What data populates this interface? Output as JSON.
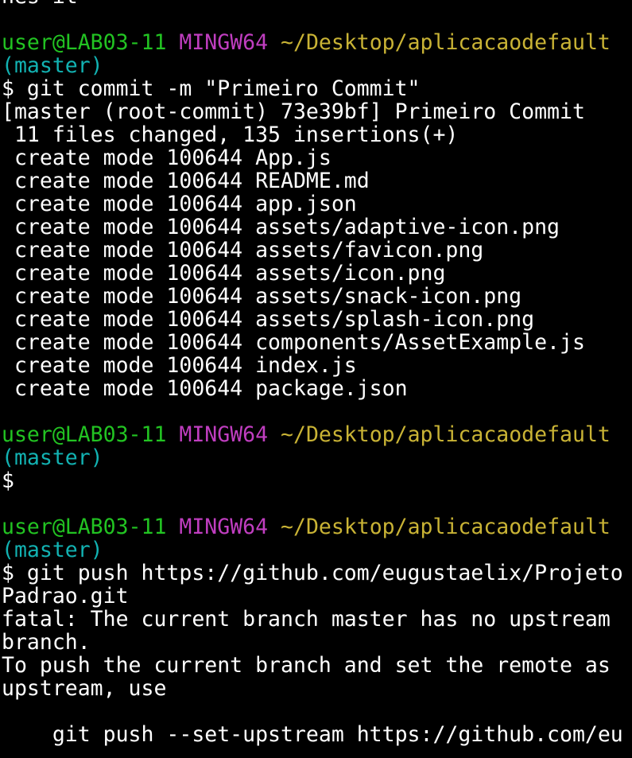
{
  "colors": {
    "background": "#000000",
    "text": "#ffffff",
    "user_host": "#22c322",
    "shell": "#c03ec0",
    "path": "#c9b335",
    "branch": "#12b2b2"
  },
  "lines": [
    {
      "segments": [
        {
          "text": "hes it",
          "color": "white"
        }
      ]
    },
    {
      "segments": []
    },
    {
      "segments": [
        {
          "text": "user@LAB03-11",
          "color": "green"
        },
        {
          "text": " ",
          "color": "white"
        },
        {
          "text": "MINGW64",
          "color": "magenta"
        },
        {
          "text": " ",
          "color": "white"
        },
        {
          "text": "~/Desktop/aplicacaodefault",
          "color": "yellow"
        }
      ]
    },
    {
      "segments": [
        {
          "text": "(master)",
          "color": "cyan"
        }
      ]
    },
    {
      "segments": [
        {
          "text": "$ git commit -m \"Primeiro Commit\"",
          "color": "white"
        }
      ]
    },
    {
      "segments": [
        {
          "text": "[master (root-commit) 73e39bf] Primeiro Commit",
          "color": "white"
        }
      ]
    },
    {
      "segments": [
        {
          "text": " 11 files changed, 135 insertions(+)",
          "color": "white"
        }
      ]
    },
    {
      "segments": [
        {
          "text": " create mode 100644 App.js",
          "color": "white"
        }
      ]
    },
    {
      "segments": [
        {
          "text": " create mode 100644 README.md",
          "color": "white"
        }
      ]
    },
    {
      "segments": [
        {
          "text": " create mode 100644 app.json",
          "color": "white"
        }
      ]
    },
    {
      "segments": [
        {
          "text": " create mode 100644 assets/adaptive-icon.png",
          "color": "white"
        }
      ]
    },
    {
      "segments": [
        {
          "text": " create mode 100644 assets/favicon.png",
          "color": "white"
        }
      ]
    },
    {
      "segments": [
        {
          "text": " create mode 100644 assets/icon.png",
          "color": "white"
        }
      ]
    },
    {
      "segments": [
        {
          "text": " create mode 100644 assets/snack-icon.png",
          "color": "white"
        }
      ]
    },
    {
      "segments": [
        {
          "text": " create mode 100644 assets/splash-icon.png",
          "color": "white"
        }
      ]
    },
    {
      "segments": [
        {
          "text": " create mode 100644 components/AssetExample.js",
          "color": "white"
        }
      ]
    },
    {
      "segments": [
        {
          "text": " create mode 100644 index.js",
          "color": "white"
        }
      ]
    },
    {
      "segments": [
        {
          "text": " create mode 100644 package.json",
          "color": "white"
        }
      ]
    },
    {
      "segments": []
    },
    {
      "segments": [
        {
          "text": "user@LAB03-11",
          "color": "green"
        },
        {
          "text": " ",
          "color": "white"
        },
        {
          "text": "MINGW64",
          "color": "magenta"
        },
        {
          "text": " ",
          "color": "white"
        },
        {
          "text": "~/Desktop/aplicacaodefault",
          "color": "yellow"
        }
      ]
    },
    {
      "segments": [
        {
          "text": "(master)",
          "color": "cyan"
        }
      ]
    },
    {
      "segments": [
        {
          "text": "$",
          "color": "white"
        }
      ]
    },
    {
      "segments": []
    },
    {
      "segments": [
        {
          "text": "user@LAB03-11",
          "color": "green"
        },
        {
          "text": " ",
          "color": "white"
        },
        {
          "text": "MINGW64",
          "color": "magenta"
        },
        {
          "text": " ",
          "color": "white"
        },
        {
          "text": "~/Desktop/aplicacaodefault",
          "color": "yellow"
        }
      ]
    },
    {
      "segments": [
        {
          "text": "(master)",
          "color": "cyan"
        }
      ]
    },
    {
      "segments": [
        {
          "text": "$ git push https://github.com/eugustaelix/Projeto",
          "color": "white"
        }
      ]
    },
    {
      "segments": [
        {
          "text": "Padrao.git",
          "color": "white"
        }
      ]
    },
    {
      "segments": [
        {
          "text": "fatal: The current branch master has no upstream",
          "color": "white"
        }
      ]
    },
    {
      "segments": [
        {
          "text": "branch.",
          "color": "white"
        }
      ]
    },
    {
      "segments": [
        {
          "text": "To push the current branch and set the remote as",
          "color": "white"
        }
      ]
    },
    {
      "segments": [
        {
          "text": "upstream, use",
          "color": "white"
        }
      ]
    },
    {
      "segments": []
    },
    {
      "segments": [
        {
          "text": "    git push --set-upstream https://github.com/eu",
          "color": "white"
        }
      ]
    }
  ]
}
